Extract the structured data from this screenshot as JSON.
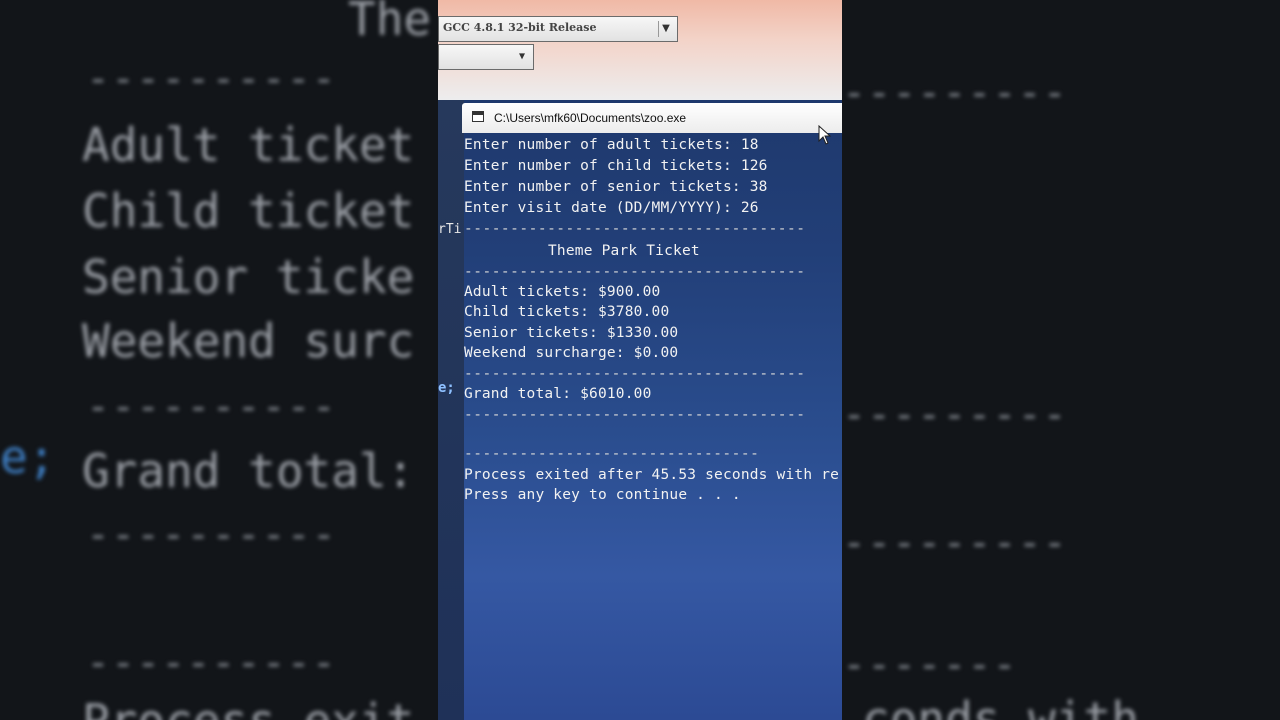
{
  "ide": {
    "compiler_select": "GCC 4.8.1 32-bit Release"
  },
  "console": {
    "window_title": "C:\\Users\\mfk60\\Documents\\zoo.exe",
    "lines": {
      "adult_prompt": "Enter number of adult tickets: 18",
      "child_prompt": "Enter number of child tickets: 126",
      "senior_prompt": "Enter number of senior tickets: 38",
      "date_prompt": "Enter visit date (DD/MM/YYYY): 26",
      "dash1": "-------------------------------------",
      "heading": "Theme Park Ticket",
      "dash2": "-------------------------------------",
      "adult_total": "Adult tickets: $900.00",
      "child_total": "Child tickets: $3780.00",
      "senior_total": "Senior tickets: $1330.00",
      "weekend": "Weekend surcharge: $0.00",
      "dash3": "-------------------------------------",
      "grand_total": "Grand total: $6010.00",
      "dash4": "-------------------------------------",
      "dash5": "--------------------------------",
      "process_exit": "Process exited after 45.53 seconds with re",
      "press_key": "Press any key to continue . . ."
    }
  },
  "sliver": {
    "text1": "rTi",
    "text2": "e;"
  },
  "background": {
    "left_top": "The",
    "left_adult": "Adult ticket",
    "left_child": "Child ticket",
    "left_senior": "Senior ticke",
    "left_weekend": "Weekend surc",
    "left_semi": "e;",
    "left_grand": "Grand total:",
    "left_bottom": "Process exit",
    "right_bottom": "conds with"
  },
  "colors": {
    "console_bg": "#223f78",
    "console_text": "#f2f2f2",
    "titlebar": "#ececec"
  }
}
